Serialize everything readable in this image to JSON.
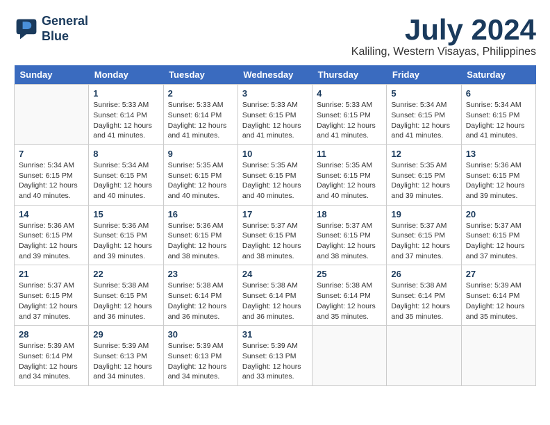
{
  "header": {
    "logo_line1": "General",
    "logo_line2": "Blue",
    "month_title": "July 2024",
    "location": "Kaliling, Western Visayas, Philippines"
  },
  "calendar": {
    "days_of_week": [
      "Sunday",
      "Monday",
      "Tuesday",
      "Wednesday",
      "Thursday",
      "Friday",
      "Saturday"
    ],
    "weeks": [
      [
        {
          "day": "",
          "content": ""
        },
        {
          "day": "1",
          "content": "Sunrise: 5:33 AM\nSunset: 6:14 PM\nDaylight: 12 hours\nand 41 minutes."
        },
        {
          "day": "2",
          "content": "Sunrise: 5:33 AM\nSunset: 6:14 PM\nDaylight: 12 hours\nand 41 minutes."
        },
        {
          "day": "3",
          "content": "Sunrise: 5:33 AM\nSunset: 6:15 PM\nDaylight: 12 hours\nand 41 minutes."
        },
        {
          "day": "4",
          "content": "Sunrise: 5:33 AM\nSunset: 6:15 PM\nDaylight: 12 hours\nand 41 minutes."
        },
        {
          "day": "5",
          "content": "Sunrise: 5:34 AM\nSunset: 6:15 PM\nDaylight: 12 hours\nand 41 minutes."
        },
        {
          "day": "6",
          "content": "Sunrise: 5:34 AM\nSunset: 6:15 PM\nDaylight: 12 hours\nand 41 minutes."
        }
      ],
      [
        {
          "day": "7",
          "content": "Sunrise: 5:34 AM\nSunset: 6:15 PM\nDaylight: 12 hours\nand 40 minutes."
        },
        {
          "day": "8",
          "content": "Sunrise: 5:34 AM\nSunset: 6:15 PM\nDaylight: 12 hours\nand 40 minutes."
        },
        {
          "day": "9",
          "content": "Sunrise: 5:35 AM\nSunset: 6:15 PM\nDaylight: 12 hours\nand 40 minutes."
        },
        {
          "day": "10",
          "content": "Sunrise: 5:35 AM\nSunset: 6:15 PM\nDaylight: 12 hours\nand 40 minutes."
        },
        {
          "day": "11",
          "content": "Sunrise: 5:35 AM\nSunset: 6:15 PM\nDaylight: 12 hours\nand 40 minutes."
        },
        {
          "day": "12",
          "content": "Sunrise: 5:35 AM\nSunset: 6:15 PM\nDaylight: 12 hours\nand 39 minutes."
        },
        {
          "day": "13",
          "content": "Sunrise: 5:36 AM\nSunset: 6:15 PM\nDaylight: 12 hours\nand 39 minutes."
        }
      ],
      [
        {
          "day": "14",
          "content": "Sunrise: 5:36 AM\nSunset: 6:15 PM\nDaylight: 12 hours\nand 39 minutes."
        },
        {
          "day": "15",
          "content": "Sunrise: 5:36 AM\nSunset: 6:15 PM\nDaylight: 12 hours\nand 39 minutes."
        },
        {
          "day": "16",
          "content": "Sunrise: 5:36 AM\nSunset: 6:15 PM\nDaylight: 12 hours\nand 38 minutes."
        },
        {
          "day": "17",
          "content": "Sunrise: 5:37 AM\nSunset: 6:15 PM\nDaylight: 12 hours\nand 38 minutes."
        },
        {
          "day": "18",
          "content": "Sunrise: 5:37 AM\nSunset: 6:15 PM\nDaylight: 12 hours\nand 38 minutes."
        },
        {
          "day": "19",
          "content": "Sunrise: 5:37 AM\nSunset: 6:15 PM\nDaylight: 12 hours\nand 37 minutes."
        },
        {
          "day": "20",
          "content": "Sunrise: 5:37 AM\nSunset: 6:15 PM\nDaylight: 12 hours\nand 37 minutes."
        }
      ],
      [
        {
          "day": "21",
          "content": "Sunrise: 5:37 AM\nSunset: 6:15 PM\nDaylight: 12 hours\nand 37 minutes."
        },
        {
          "day": "22",
          "content": "Sunrise: 5:38 AM\nSunset: 6:15 PM\nDaylight: 12 hours\nand 36 minutes."
        },
        {
          "day": "23",
          "content": "Sunrise: 5:38 AM\nSunset: 6:14 PM\nDaylight: 12 hours\nand 36 minutes."
        },
        {
          "day": "24",
          "content": "Sunrise: 5:38 AM\nSunset: 6:14 PM\nDaylight: 12 hours\nand 36 minutes."
        },
        {
          "day": "25",
          "content": "Sunrise: 5:38 AM\nSunset: 6:14 PM\nDaylight: 12 hours\nand 35 minutes."
        },
        {
          "day": "26",
          "content": "Sunrise: 5:38 AM\nSunset: 6:14 PM\nDaylight: 12 hours\nand 35 minutes."
        },
        {
          "day": "27",
          "content": "Sunrise: 5:39 AM\nSunset: 6:14 PM\nDaylight: 12 hours\nand 35 minutes."
        }
      ],
      [
        {
          "day": "28",
          "content": "Sunrise: 5:39 AM\nSunset: 6:14 PM\nDaylight: 12 hours\nand 34 minutes."
        },
        {
          "day": "29",
          "content": "Sunrise: 5:39 AM\nSunset: 6:13 PM\nDaylight: 12 hours\nand 34 minutes."
        },
        {
          "day": "30",
          "content": "Sunrise: 5:39 AM\nSunset: 6:13 PM\nDaylight: 12 hours\nand 34 minutes."
        },
        {
          "day": "31",
          "content": "Sunrise: 5:39 AM\nSunset: 6:13 PM\nDaylight: 12 hours\nand 33 minutes."
        },
        {
          "day": "",
          "content": ""
        },
        {
          "day": "",
          "content": ""
        },
        {
          "day": "",
          "content": ""
        }
      ]
    ]
  }
}
